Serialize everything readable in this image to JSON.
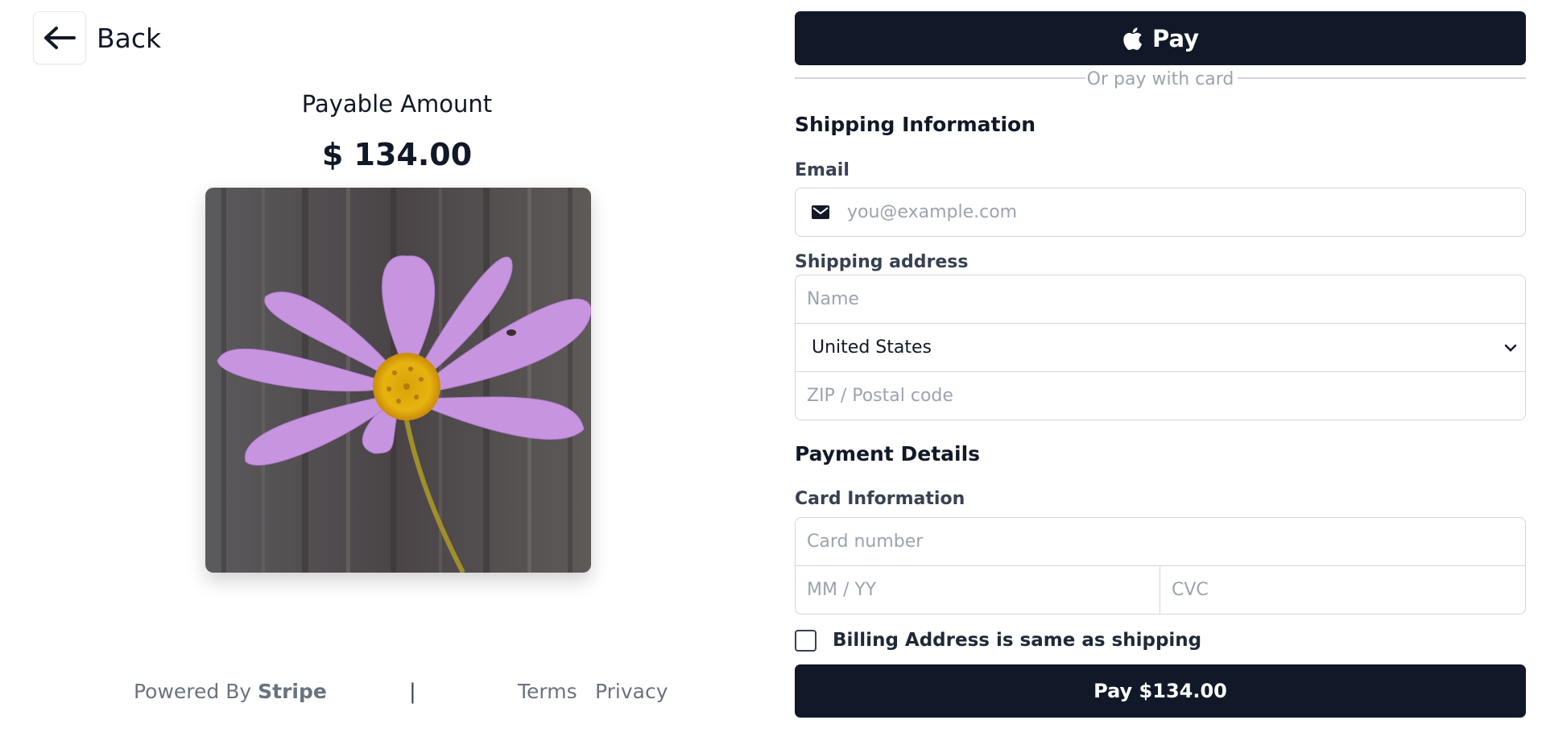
{
  "header": {
    "back_label": "Back"
  },
  "summary": {
    "amount_label": "Payable Amount",
    "amount": "$ 134.00"
  },
  "footer": {
    "powered_by": "Powered By",
    "brand": "Stripe",
    "separator": "|",
    "terms": "Terms",
    "privacy": "Privacy"
  },
  "wallet": {
    "pay_label": "Pay",
    "divider_text": "Or pay with card"
  },
  "shipping": {
    "title": "Shipping Information",
    "email_label": "Email",
    "email_placeholder": "you@example.com",
    "address_label": "Shipping address",
    "name_placeholder": "Name",
    "country": "United States",
    "zip_placeholder": "ZIP / Postal code"
  },
  "payment": {
    "title": "Payment Details",
    "card_label": "Card Information",
    "card_number_placeholder": "Card number",
    "expiry_placeholder": "MM / YY",
    "cvc_placeholder": "CVC",
    "billing_same_label": "Billing Address is same as shipping",
    "billing_same_checked": false,
    "pay_button_label": "Pay $134.00"
  },
  "colors": {
    "primary_button": "#111827",
    "text_muted": "#6b7280",
    "border": "#d1d5db"
  },
  "icons": {
    "back": "arrow-left-icon",
    "apple": "apple-logo-icon",
    "email": "envelope-icon",
    "dropdown": "chevron-down-icon"
  }
}
